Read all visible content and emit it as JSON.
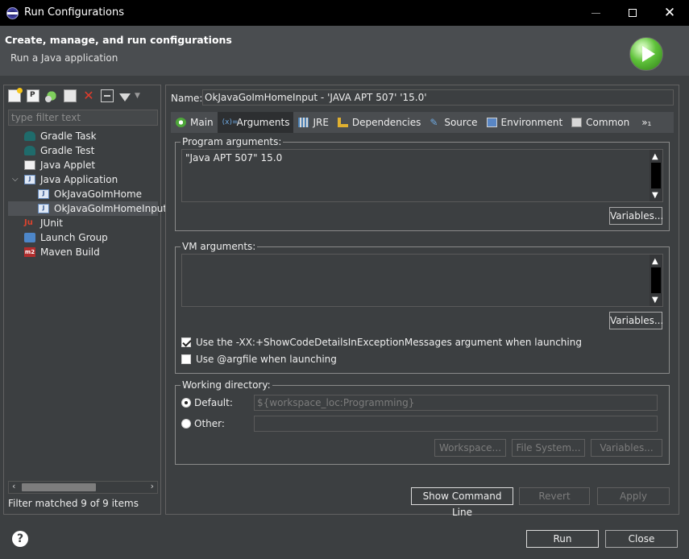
{
  "window": {
    "title": "Run Configurations",
    "close_glyph": "✕"
  },
  "banner": {
    "title": "Create, manage, and run configurations",
    "subtitle": "Run a Java application"
  },
  "left": {
    "filter_placeholder": "type filter text",
    "tree": [
      {
        "label": "Gradle Task"
      },
      {
        "label": "Gradle Test"
      },
      {
        "label": "Java Applet"
      },
      {
        "label": "Java Application",
        "expanded": true
      },
      {
        "label": "OkJavaGoImHome"
      },
      {
        "label": "OkJavaGoImHomeInput",
        "selected": true
      },
      {
        "label": "JUnit"
      },
      {
        "label": "Launch Group"
      },
      {
        "label": "Maven Build"
      }
    ],
    "status": "Filter matched 9 of 9 items"
  },
  "config": {
    "name_label": "Name:",
    "name_value": "OkJavaGoImHomeInput - 'JAVA APT 507' '15.0'",
    "tabs": [
      {
        "label": "Main",
        "icon": "main-icon"
      },
      {
        "label": "Arguments",
        "icon": "arguments-icon",
        "active": true
      },
      {
        "label": "JRE",
        "icon": "jre-icon"
      },
      {
        "label": "Dependencies",
        "icon": "dependencies-icon"
      },
      {
        "label": "Source",
        "icon": "source-icon"
      },
      {
        "label": "Environment",
        "icon": "environment-icon"
      },
      {
        "label": "Common",
        "icon": "common-icon"
      }
    ],
    "tabs_overflow": "»₁",
    "program_args": {
      "legend": "Program arguments:",
      "value": "\"Java APT 507\" 15.0",
      "variables_btn": "Variables..."
    },
    "vm_args": {
      "legend": "VM arguments:",
      "value": "",
      "variables_btn": "Variables...",
      "show_code_details_label": "Use the -XX:+ShowCodeDetailsInExceptionMessages argument when launching",
      "show_code_details_checked": true,
      "argfile_label": "Use @argfile when launching",
      "argfile_checked": false
    },
    "working_dir": {
      "legend": "Working directory:",
      "default_label": "Default:",
      "default_value": "${workspace_loc:Programming}",
      "default_selected": true,
      "other_label": "Other:",
      "other_value": "",
      "workspace_btn": "Workspace...",
      "filesystem_btn": "File System...",
      "variables_btn": "Variables..."
    },
    "show_command_line_btn": "Show Command Line",
    "revert_btn": "Revert",
    "apply_btn": "Apply"
  },
  "footer": {
    "run_btn": "Run",
    "close_btn": "Close",
    "help_glyph": "?"
  },
  "colors": {
    "background": "#3c3f41",
    "banner": "#4a4d50",
    "titlebar": "#000000",
    "text": "#eeeeee"
  }
}
